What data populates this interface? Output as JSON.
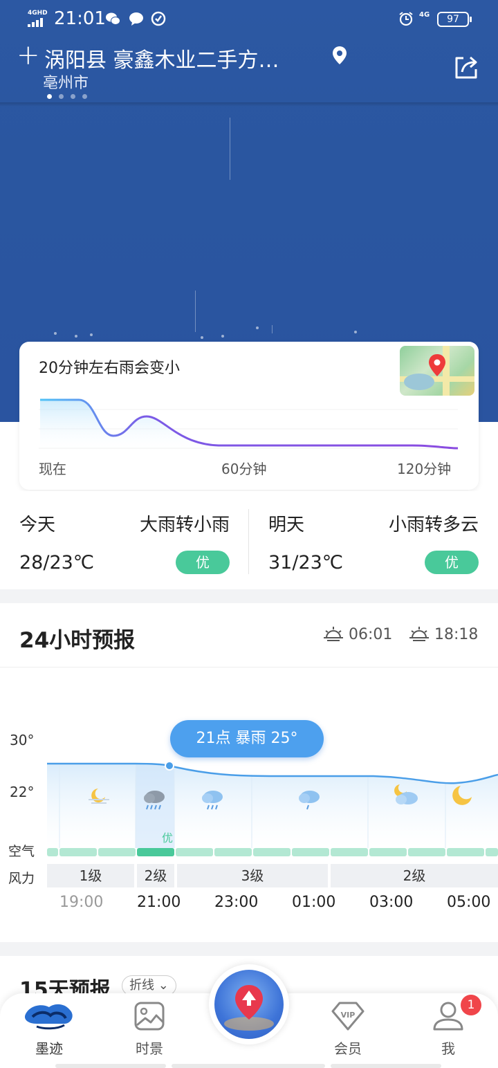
{
  "status_bar": {
    "network": "4GHD",
    "time": "21:01",
    "mobile_data": "4G",
    "battery": "97"
  },
  "header": {
    "location_title": "涡阳县 豪鑫木业二手方…",
    "city": "亳州市"
  },
  "rain_card": {
    "title": "20分钟左右雨会变小",
    "axis": [
      "现在",
      "60分钟",
      "120分钟"
    ]
  },
  "today": {
    "label": "今天",
    "condition": "大雨转小雨",
    "temp": "28/23℃",
    "aqi": "优"
  },
  "tomorrow": {
    "label": "明天",
    "condition": "小雨转多云",
    "temp": "31/23℃",
    "aqi": "优"
  },
  "hourly": {
    "title": "24小时预报",
    "sunrise": "06:01",
    "sunset": "18:18",
    "y_labels": [
      "30°",
      "22°"
    ],
    "tooltip": "21点 暴雨 25°",
    "air_label": "空气",
    "wind_label": "风力",
    "selected_aqi": "优",
    "wind_levels": [
      "1级",
      "2级",
      "3级",
      "2级"
    ],
    "times": [
      "19:00",
      "21:00",
      "23:00",
      "01:00",
      "03:00",
      "05:00"
    ]
  },
  "days15": {
    "title": "15天预报",
    "mode": "折线"
  },
  "nav": {
    "items": [
      "墨迹",
      "时景",
      "会员",
      "我"
    ],
    "badge": "1"
  },
  "colors": {
    "sky": "#2a56a0",
    "accent_blue": "#4da0ee",
    "aqi_green": "#49c99a",
    "badge_red": "#f0454a"
  }
}
